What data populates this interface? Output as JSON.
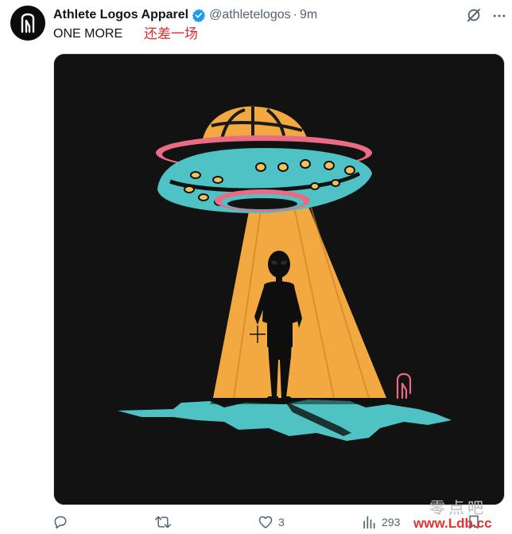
{
  "tweet": {
    "display_name": "Athlete Logos Apparel",
    "handle": "@athletelogos",
    "separator": "·",
    "time": "9m",
    "text": "ONE MORE",
    "annotation": "还差一场",
    "verified": true
  },
  "actions": {
    "reply_icon": "reply-icon",
    "retweet_icon": "retweet-icon",
    "like_icon": "heart-icon",
    "like_count": "3",
    "views_icon": "bar-chart-icon",
    "views_count": "293",
    "bookmark_icon": "bookmark-icon"
  },
  "watermark": {
    "top": "零点吧",
    "bottom": "www.Ldb.cc"
  },
  "colors": {
    "brand_blue": "#1d9bf0",
    "muted_text": "#536471",
    "annotation_red": "#e0292b",
    "media_background": "#121212",
    "beam_orange": "#f2a941",
    "ufo_teal": "#4ec2c4",
    "ufo_pink": "#e96b86"
  }
}
